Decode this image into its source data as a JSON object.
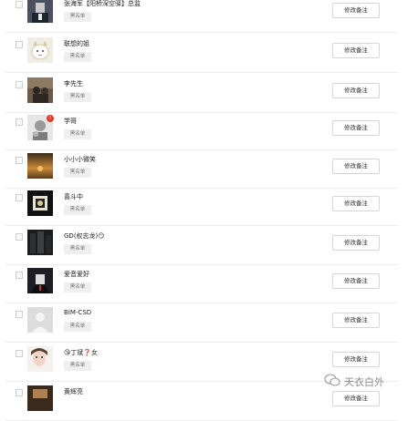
{
  "tag_label": "黑名单",
  "button_label": "修改备注",
  "contacts": [
    {
      "name": "张海军【阳桥深空驿】总监"
    },
    {
      "name": "联想的姐"
    },
    {
      "name": "李先生"
    },
    {
      "name": "学哥"
    },
    {
      "name": "小小小微笑"
    },
    {
      "name": "喜斗中"
    },
    {
      "name": "GD(权志龙)😏"
    },
    {
      "name": "爱音爱好"
    },
    {
      "name": "BIM-CSD"
    },
    {
      "name": "😘丁斌❓女"
    },
    {
      "name": "黄辉亮"
    }
  ],
  "watermark": {
    "text": "天衣白外"
  }
}
